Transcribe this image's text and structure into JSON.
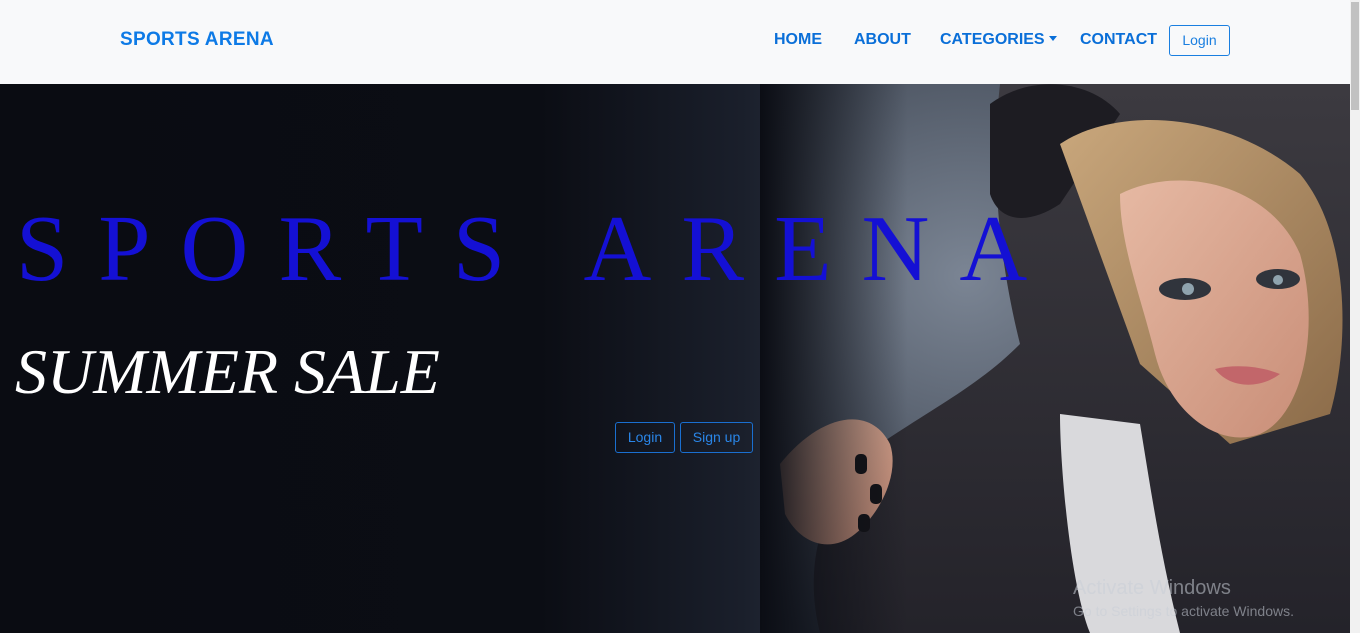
{
  "navbar": {
    "brand": "SPORTS ARENA",
    "links": [
      "HOME",
      "ABOUT",
      "CATEGORIES",
      "CONTACT"
    ],
    "login_label": "Login"
  },
  "hero": {
    "title": "SPORTS ARENA",
    "subtitle": "SUMMER SALE",
    "login_label": "Login",
    "signup_label": "Sign up"
  },
  "watermark": {
    "title": "Activate Windows",
    "subtitle": "Go to Settings to activate Windows."
  },
  "colors": {
    "brand": "#0d7ae6",
    "hero_title": "#1410d4",
    "navbar_bg": "#f8f9fa"
  },
  "icons": [
    "chevron-down-icon"
  ]
}
